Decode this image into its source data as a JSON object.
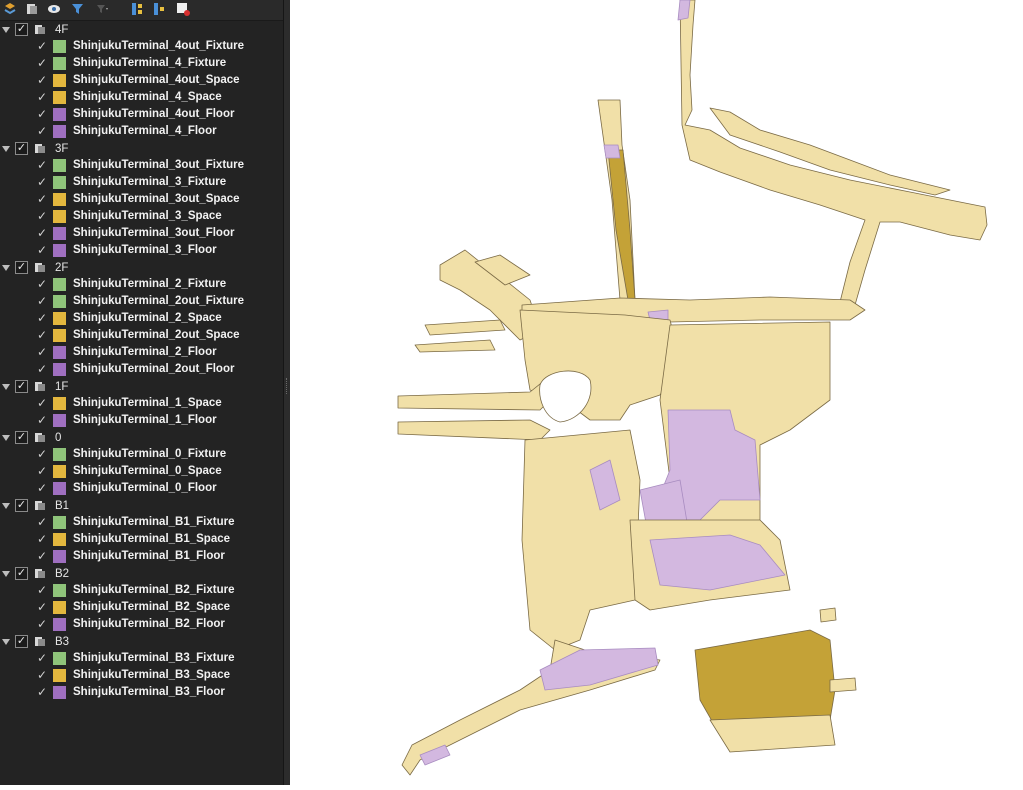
{
  "colors": {
    "fixture": "#8fc47a",
    "space": "#e3b73e",
    "floor": "#9f6fc0",
    "map_space": "#f1e0a8",
    "map_outline": "#7a6a45",
    "map_floor": "#d3b8e0",
    "map_dark": "#c4a237"
  },
  "toolbar": {
    "icons": [
      "style-icon",
      "add-group-icon",
      "visibility-icon",
      "filter-icon",
      "filter-legend-icon",
      "expand-all-icon",
      "collapse-all-icon",
      "remove-layer-icon"
    ]
  },
  "layers": {
    "groups": [
      {
        "name": "4F",
        "items": [
          {
            "name": "ShinjukuTerminal_4out_Fixture",
            "kind": "fixture"
          },
          {
            "name": "ShinjukuTerminal_4_Fixture",
            "kind": "fixture"
          },
          {
            "name": "ShinjukuTerminal_4out_Space",
            "kind": "space"
          },
          {
            "name": "ShinjukuTerminal_4_Space",
            "kind": "space"
          },
          {
            "name": "ShinjukuTerminal_4out_Floor",
            "kind": "floor"
          },
          {
            "name": "ShinjukuTerminal_4_Floor",
            "kind": "floor"
          }
        ]
      },
      {
        "name": "3F",
        "items": [
          {
            "name": "ShinjukuTerminal_3out_Fixture",
            "kind": "fixture"
          },
          {
            "name": "ShinjukuTerminal_3_Fixture",
            "kind": "fixture"
          },
          {
            "name": "ShinjukuTerminal_3out_Space",
            "kind": "space"
          },
          {
            "name": "ShinjukuTerminal_3_Space",
            "kind": "space"
          },
          {
            "name": "ShinjukuTerminal_3out_Floor",
            "kind": "floor"
          },
          {
            "name": "ShinjukuTerminal_3_Floor",
            "kind": "floor"
          }
        ]
      },
      {
        "name": "2F",
        "items": [
          {
            "name": "ShinjukuTerminal_2_Fixture",
            "kind": "fixture"
          },
          {
            "name": "ShinjukuTerminal_2out_Fixture",
            "kind": "fixture"
          },
          {
            "name": "ShinjukuTerminal_2_Space",
            "kind": "space"
          },
          {
            "name": "ShinjukuTerminal_2out_Space",
            "kind": "space"
          },
          {
            "name": "ShinjukuTerminal_2_Floor",
            "kind": "floor"
          },
          {
            "name": "ShinjukuTerminal_2out_Floor",
            "kind": "floor"
          }
        ]
      },
      {
        "name": "1F",
        "items": [
          {
            "name": "ShinjukuTerminal_1_Space",
            "kind": "space"
          },
          {
            "name": "ShinjukuTerminal_1_Floor",
            "kind": "floor"
          }
        ]
      },
      {
        "name": "0",
        "items": [
          {
            "name": "ShinjukuTerminal_0_Fixture",
            "kind": "fixture"
          },
          {
            "name": "ShinjukuTerminal_0_Space",
            "kind": "space"
          },
          {
            "name": "ShinjukuTerminal_0_Floor",
            "kind": "floor"
          }
        ]
      },
      {
        "name": "B1",
        "items": [
          {
            "name": "ShinjukuTerminal_B1_Fixture",
            "kind": "fixture"
          },
          {
            "name": "ShinjukuTerminal_B1_Space",
            "kind": "space"
          },
          {
            "name": "ShinjukuTerminal_B1_Floor",
            "kind": "floor"
          }
        ]
      },
      {
        "name": "B2",
        "items": [
          {
            "name": "ShinjukuTerminal_B2_Fixture",
            "kind": "fixture"
          },
          {
            "name": "ShinjukuTerminal_B2_Space",
            "kind": "space"
          },
          {
            "name": "ShinjukuTerminal_B2_Floor",
            "kind": "floor"
          }
        ]
      },
      {
        "name": "B3",
        "items": [
          {
            "name": "ShinjukuTerminal_B3_Fixture",
            "kind": "fixture"
          },
          {
            "name": "ShinjukuTerminal_B3_Space",
            "kind": "space"
          },
          {
            "name": "ShinjukuTerminal_B3_Floor",
            "kind": "floor"
          }
        ]
      }
    ]
  }
}
